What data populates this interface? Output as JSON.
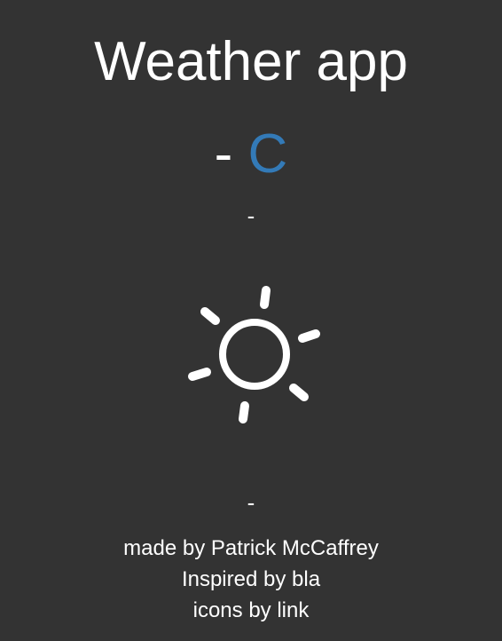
{
  "header": {
    "title": "Weather app"
  },
  "weather": {
    "temperature": "-",
    "unit": "C",
    "description": "-",
    "location": "-",
    "icon": "sun-icon"
  },
  "credits": {
    "made_by_prefix": "made by ",
    "made_by_name": "Patrick McCaffrey",
    "inspired_prefix": "Inspired by ",
    "inspired_link": "bla",
    "icons_prefix": "icons by ",
    "icons_link": "link"
  },
  "colors": {
    "background": "#333333",
    "text": "#ffffff",
    "unit_accent": "#337ab7"
  }
}
